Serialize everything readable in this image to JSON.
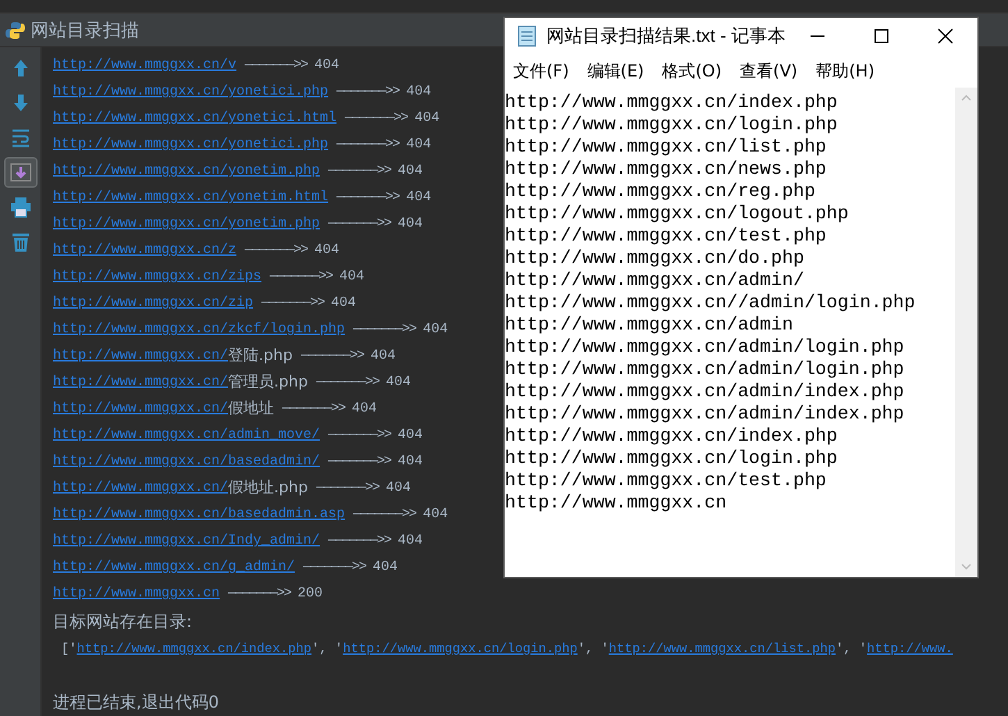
{
  "run_tab": {
    "title": "网站目录扫描"
  },
  "toolbar": [
    {
      "kind": "up",
      "selected": false
    },
    {
      "kind": "down",
      "selected": false
    },
    {
      "kind": "wrap",
      "selected": false
    },
    {
      "kind": "scroll",
      "selected": true
    },
    {
      "kind": "print",
      "selected": false
    },
    {
      "kind": "trash",
      "selected": false
    }
  ],
  "console": {
    "results": [
      {
        "link": "http://www.mmggxx.cn/v",
        "arrow": "———————>>",
        "status": "404"
      },
      {
        "link": "http://www.mmggxx.cn/yonetici.php",
        "arrow": "———————>>",
        "status": "404"
      },
      {
        "link": "http://www.mmggxx.cn/yonetici.html",
        "arrow": "———————>>",
        "status": "404"
      },
      {
        "link": "http://www.mmggxx.cn/yonetici.php",
        "arrow": "———————>>",
        "status": "404"
      },
      {
        "link": "http://www.mmggxx.cn/yonetim.php",
        "arrow": "———————>>",
        "status": "404"
      },
      {
        "link": "http://www.mmggxx.cn/yonetim.html",
        "arrow": "———————>>",
        "status": "404"
      },
      {
        "link": "http://www.mmggxx.cn/yonetim.php",
        "arrow": "———————>>",
        "status": "404"
      },
      {
        "link": "http://www.mmggxx.cn/z",
        "arrow": "———————>>",
        "status": "404"
      },
      {
        "link": "http://www.mmggxx.cn/zips",
        "arrow": "———————>>",
        "status": "404"
      },
      {
        "link": "http://www.mmggxx.cn/zip",
        "arrow": "———————>>",
        "status": "404"
      },
      {
        "link": "http://www.mmggxx.cn/zkcf/login.php",
        "arrow": "———————>>",
        "status": "404"
      },
      {
        "link": "http://www.mmggxx.cn/",
        "tail": "登陆.php",
        "arrow": "———————>>",
        "status": "404"
      },
      {
        "link": "http://www.mmggxx.cn/",
        "tail": "管理员.php",
        "arrow": "———————>>",
        "status": "404"
      },
      {
        "link": "http://www.mmggxx.cn/",
        "tail": "假地址",
        "arrow": "———————>>",
        "status": "404"
      },
      {
        "link": "http://www.mmggxx.cn/admin_move/",
        "arrow": "———————>>",
        "status": "404"
      },
      {
        "link": "http://www.mmggxx.cn/basedadmin/",
        "arrow": "———————>>",
        "status": "404"
      },
      {
        "link": "http://www.mmggxx.cn/",
        "tail": "假地址.php",
        "arrow": "———————>>",
        "status": "404"
      },
      {
        "link": "http://www.mmggxx.cn/basedadmin.asp",
        "arrow": "———————>>",
        "status": "404"
      },
      {
        "link": "http://www.mmggxx.cn/Indy_admin/",
        "arrow": "———————>>",
        "status": "404"
      },
      {
        "link": "http://www.mmggxx.cn/g_admin/",
        "arrow": "———————>>",
        "status": "404"
      },
      {
        "link": "http://www.mmggxx.cn",
        "arrow": "———————>>",
        "status": "200"
      }
    ],
    "found_label": "目标网站存在目录:",
    "found_list": {
      "open": "['",
      "separator": "', '",
      "items": [
        "http://www.mmggxx.cn/index.php",
        "http://www.mmggxx.cn/login.php",
        "http://www.mmggxx.cn/list.php",
        "http://www."
      ]
    },
    "exit_message": "进程已结束,退出代码0"
  },
  "notepad": {
    "title": "网站目录扫描结果.txt - 记事本",
    "menu": [
      "文件(F)",
      "编辑(E)",
      "格式(O)",
      "查看(V)",
      "帮助(H)"
    ],
    "lines": [
      "http://www.mmggxx.cn/index.php",
      "http://www.mmggxx.cn/login.php",
      "http://www.mmggxx.cn/list.php",
      "http://www.mmggxx.cn/news.php",
      "http://www.mmggxx.cn/reg.php",
      "http://www.mmggxx.cn/logout.php",
      "http://www.mmggxx.cn/test.php",
      "http://www.mmggxx.cn/do.php",
      "http://www.mmggxx.cn/admin/",
      "http://www.mmggxx.cn//admin/login.php",
      "http://www.mmggxx.cn/admin",
      "http://www.mmggxx.cn/admin/login.php",
      "http://www.mmggxx.cn/admin/login.php",
      "http://www.mmggxx.cn/admin/index.php",
      "http://www.mmggxx.cn/admin/index.php",
      "http://www.mmggxx.cn/index.php",
      "http://www.mmggxx.cn/login.php",
      "http://www.mmggxx.cn/test.php",
      "http://www.mmggxx.cn"
    ]
  }
}
